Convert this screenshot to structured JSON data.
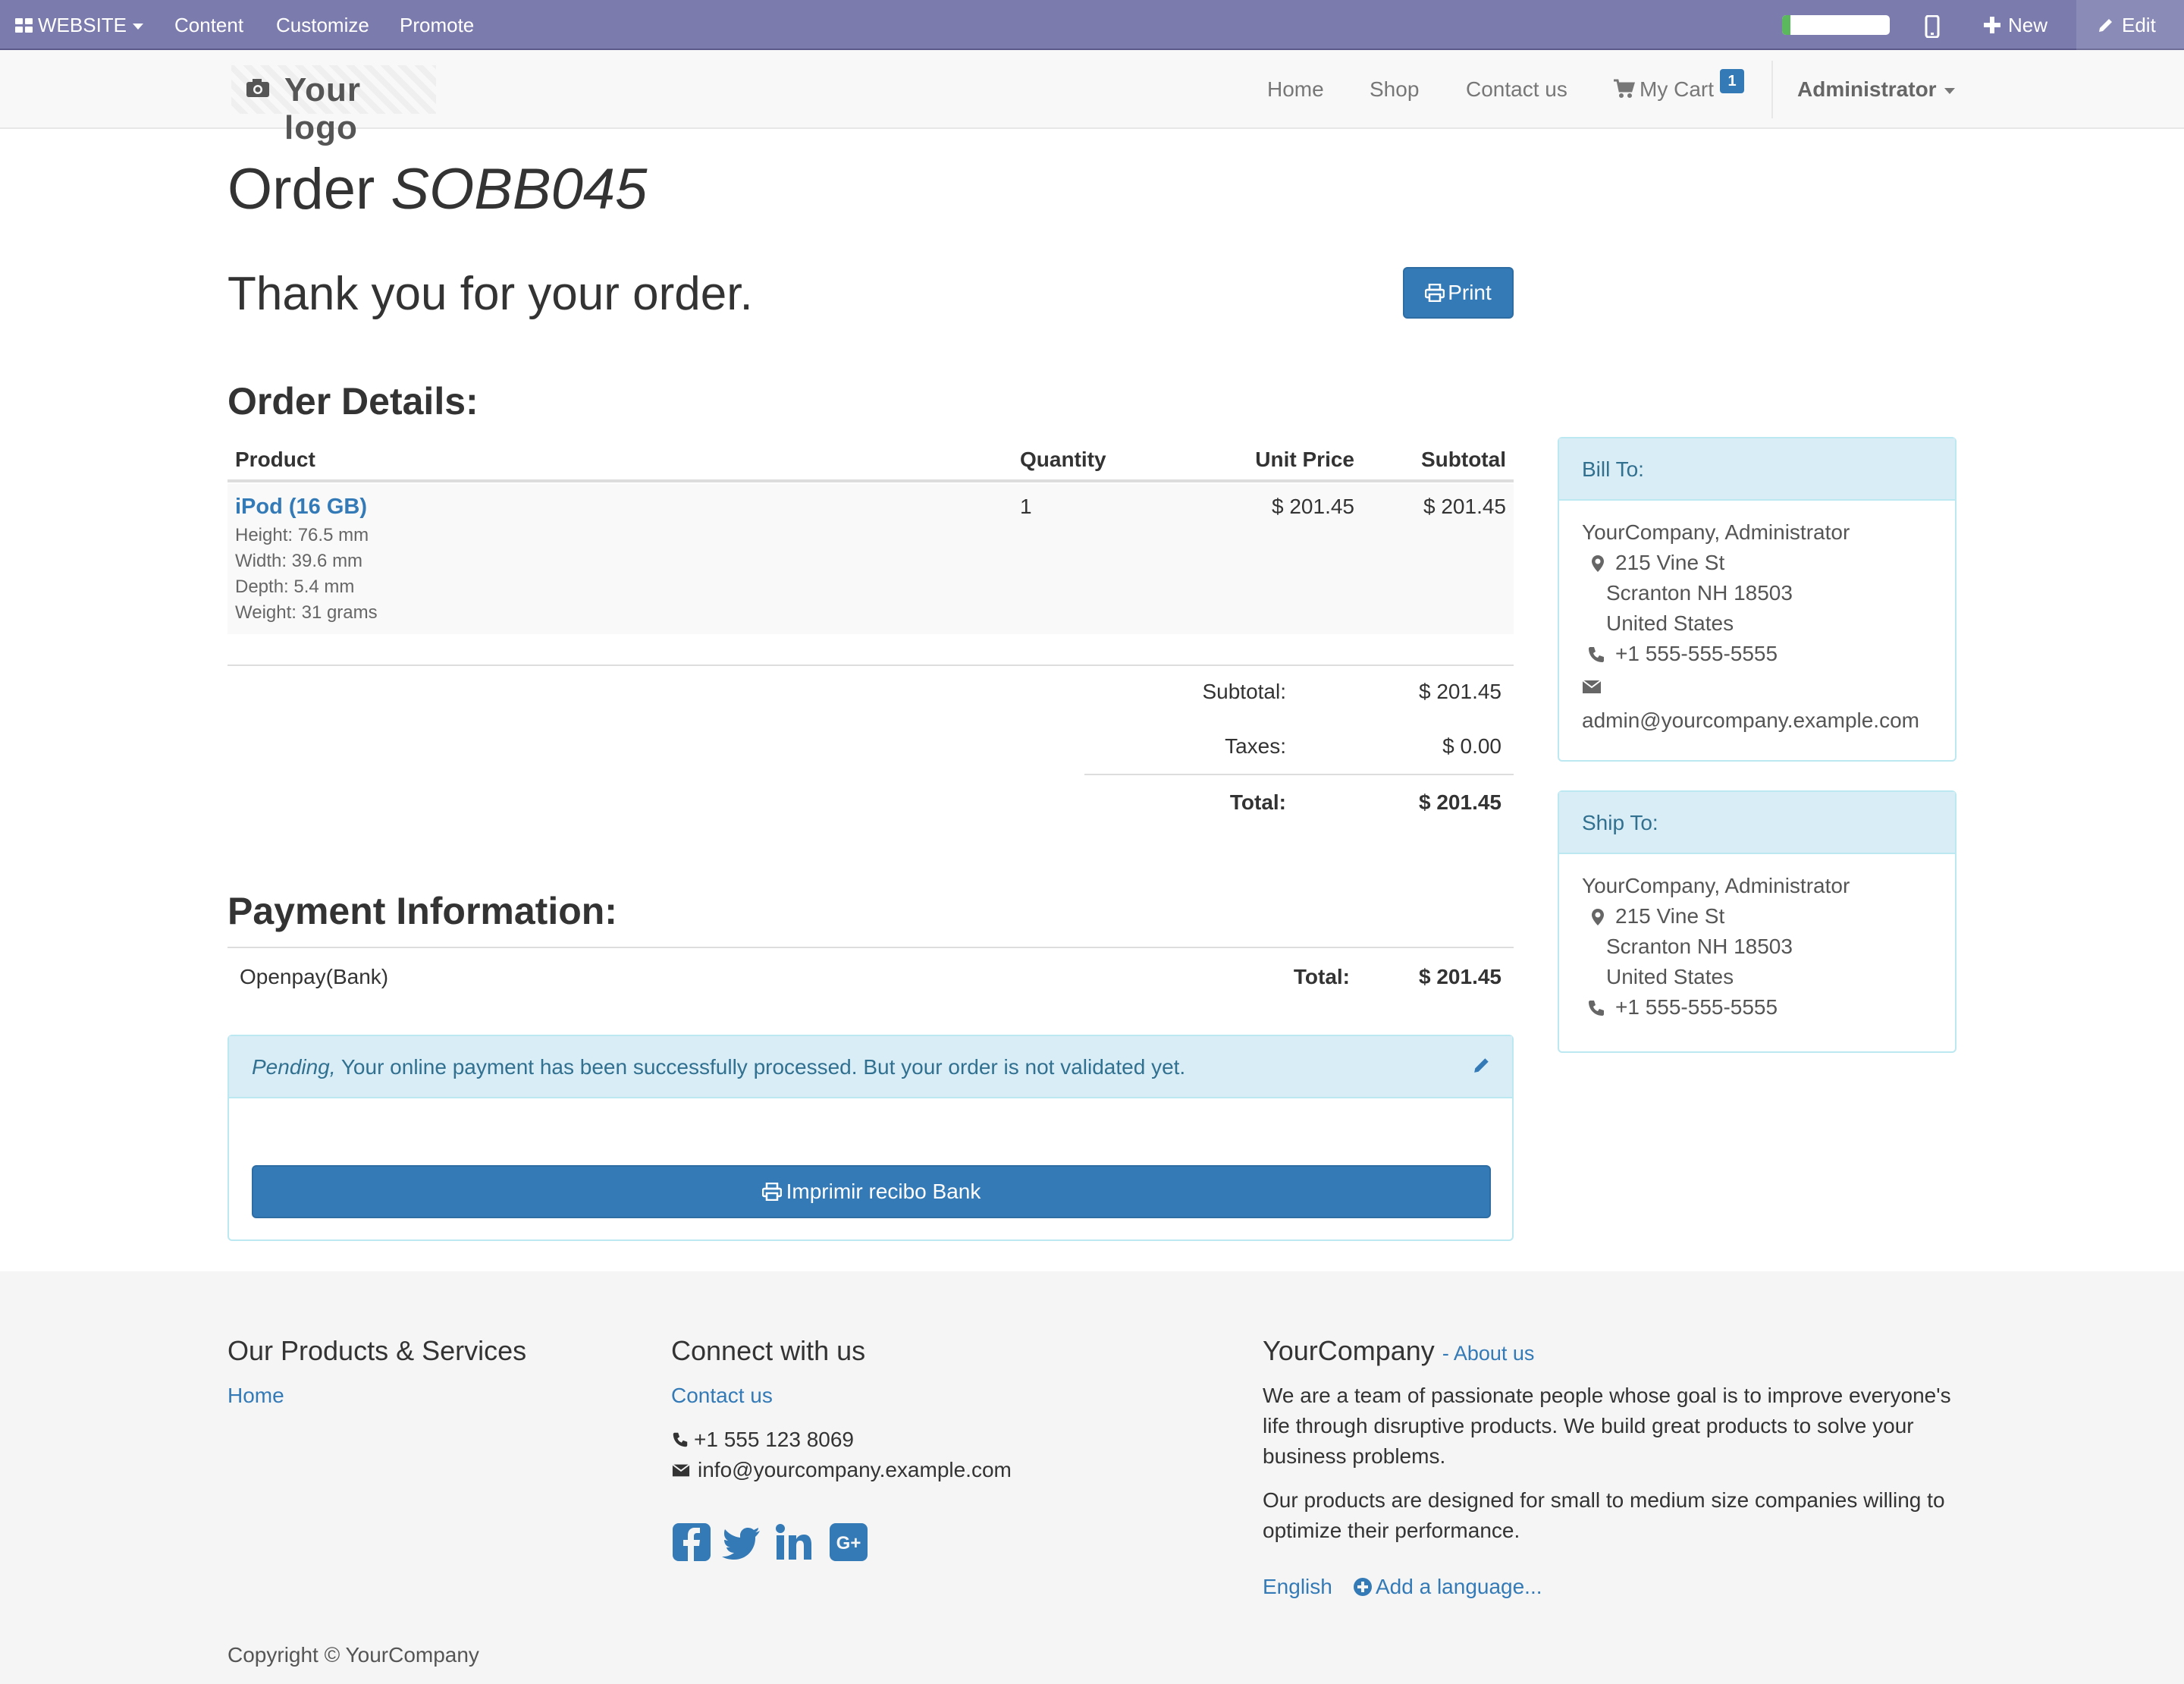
{
  "admin_bar": {
    "website_label": "WEBSITE",
    "content_label": "Content",
    "customize_label": "Customize",
    "promote_label": "Promote",
    "new_label": "New",
    "edit_label": "Edit",
    "progress_fraction": 0.08
  },
  "navbar": {
    "logo_text": "Your logo",
    "home": "Home",
    "shop": "Shop",
    "contact": "Contact us",
    "cart": "My Cart",
    "cart_count": "1",
    "user": "Administrator"
  },
  "order": {
    "label": "Order",
    "number": "SOBB045",
    "thanks": "Thank you for your order.",
    "print_label": "Print",
    "details_title": "Order Details:",
    "columns": [
      "Product",
      "Quantity",
      "Unit Price",
      "Subtotal"
    ],
    "line": {
      "product": "iPod (16 GB)",
      "attributes": [
        "Height: 76.5 mm",
        "Width: 39.6 mm",
        "Depth: 5.4 mm",
        "Weight: 31 grams"
      ],
      "quantity": "1",
      "unit_price": "$ 201.45",
      "subtotal": "$ 201.45"
    },
    "totals": {
      "subtotal_label": "Subtotal:",
      "subtotal": "$ 201.45",
      "taxes_label": "Taxes:",
      "taxes": "$ 0.00",
      "total_label": "Total:",
      "total": "$ 201.45"
    }
  },
  "payment": {
    "title": "Payment Information:",
    "method": "Openpay(Bank)",
    "total_label": "Total:",
    "total": "$ 201.45",
    "status": "Pending,",
    "message": "Your online payment has been successfully processed. But your order is not validated yet.",
    "receipt_button": "Imprimir recibo Bank"
  },
  "bill_to": {
    "title": "Bill To:",
    "name": "YourCompany, Administrator",
    "street": "215 Vine St",
    "city": "Scranton NH 18503",
    "country": "United States",
    "phone": "+1 555-555-5555",
    "email": "admin@yourcompany.example.com"
  },
  "ship_to": {
    "title": "Ship To:",
    "name": "YourCompany, Administrator",
    "street": "215 Vine St",
    "city": "Scranton NH 18503",
    "country": "United States",
    "phone": "+1 555-555-5555"
  },
  "footer": {
    "products_title": "Our Products & Services",
    "products_home": "Home",
    "connect_title": "Connect with us",
    "connect_contact": "Contact us",
    "phone": "+1 555 123 8069",
    "email": "info@yourcompany.example.com",
    "company_title": "YourCompany",
    "about_link": "- About us",
    "about_para1": "We are a team of passionate people whose goal is to improve everyone's life through disruptive products. We build great products to solve your business problems.",
    "about_para2": "Our products are designed for small to medium size companies willing to optimize their performance.",
    "language": "English",
    "add_language": "Add a language...",
    "copyright": "Copyright © YourCompany"
  },
  "colors": {
    "admin_bar": "#7c7bad",
    "primary": "#337ab7",
    "info_bg": "#d9edf7",
    "info_text": "#31708f"
  }
}
